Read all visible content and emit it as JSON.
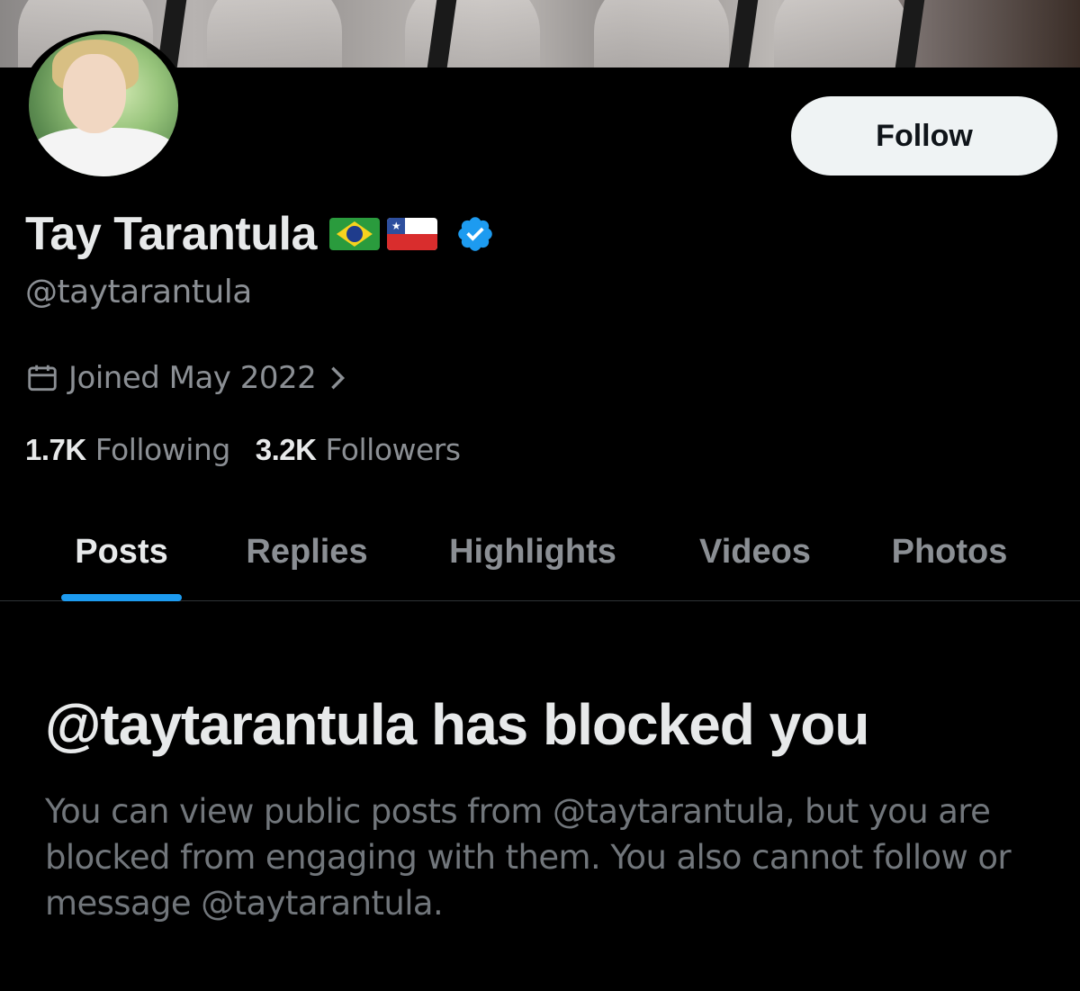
{
  "profile": {
    "display_name": "Tay Tarantula",
    "handle": "@taytarantula",
    "flags": [
      "brazil-flag",
      "chile-flag"
    ],
    "verified": true,
    "joined": "Joined May 2022",
    "follow_button_label": "Follow"
  },
  "stats": {
    "following_count": "1.7K",
    "following_label": "Following",
    "followers_count": "3.2K",
    "followers_label": "Followers"
  },
  "tabs": [
    {
      "label": "Posts",
      "active": true
    },
    {
      "label": "Replies",
      "active": false
    },
    {
      "label": "Highlights",
      "active": false
    },
    {
      "label": "Videos",
      "active": false
    },
    {
      "label": "Photos",
      "active": false
    }
  ],
  "blocked": {
    "title": "@taytarantula has blocked you",
    "body": "You can view public posts from @taytarantula, but you are blocked from engaging with them. You also cannot follow or message @taytarantula."
  },
  "colors": {
    "background": "#000000",
    "accent": "#1d9bf0",
    "primary_text": "#e7e9ea",
    "secondary_text": "#71767b"
  }
}
